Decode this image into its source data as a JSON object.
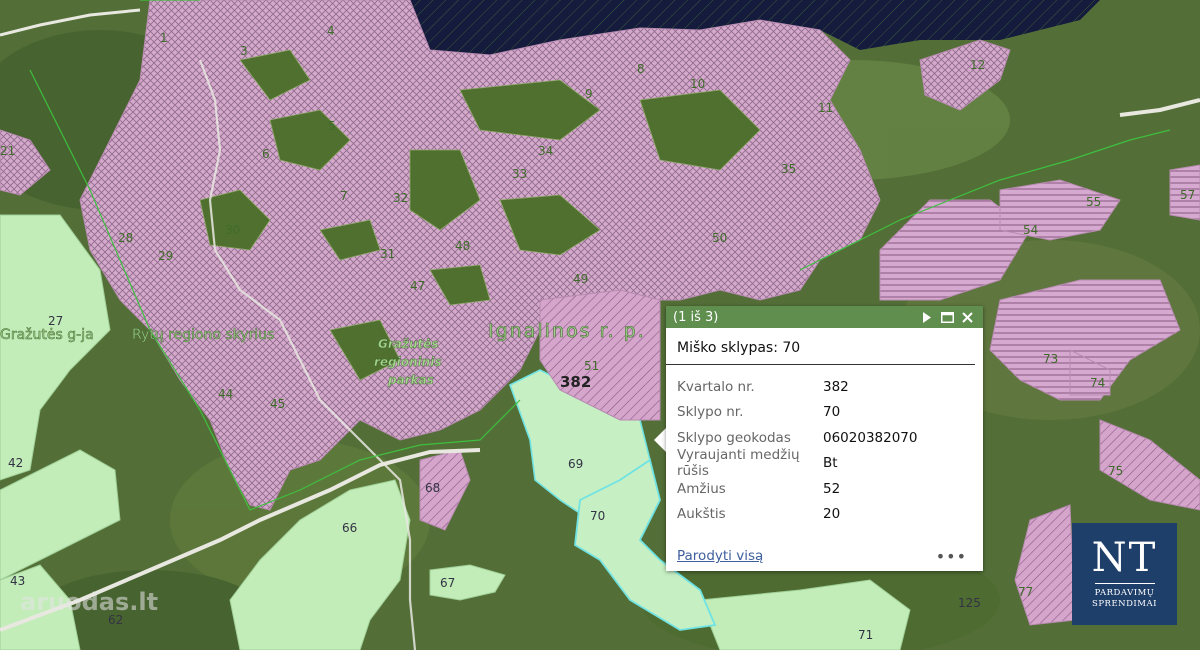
{
  "map": {
    "quarter_number": "382",
    "region_labels": {
      "district": "Ignalinos r. p.",
      "department": "Rytų regiono skyrius",
      "gazutes_forest": "Gražutės g-ja"
    },
    "park_label": [
      "Gražutės",
      "regioninis",
      "parkas"
    ],
    "plot_labels": [
      "1",
      "3",
      "4",
      "5",
      "6",
      "7",
      "8",
      "9",
      "10",
      "11",
      "12",
      "21",
      "28",
      "29",
      "30",
      "31",
      "32",
      "33",
      "34",
      "35",
      "42",
      "43",
      "44",
      "45",
      "47",
      "48",
      "49",
      "50",
      "51",
      "54",
      "55",
      "57",
      "62",
      "66",
      "67",
      "68",
      "69",
      "70",
      "71",
      "73",
      "74",
      "75",
      "77",
      "125",
      "27"
    ],
    "colors": {
      "selected_plot_fill": "#c6f0c4",
      "selected_plot_outline": "#6fe3e3",
      "protected_hatch": "#d9a9d0",
      "forest_plot_fill": "#c2ecb8"
    }
  },
  "popup": {
    "counter": "(1 iš 3)",
    "title": "Miško sklypas: 70",
    "attributes": [
      {
        "label": "Kvartalo nr.",
        "value": "382"
      },
      {
        "label": "Sklypo nr.",
        "value": "70"
      },
      {
        "label": "Sklypo geokodas",
        "value": "06020382070"
      },
      {
        "label": "Vyraujanti medžių rūšis",
        "value": "Bt"
      },
      {
        "label": "Amžius",
        "value": "52"
      },
      {
        "label": "Aukštis",
        "value": "20"
      }
    ],
    "zoom_link": "Parodyti visą",
    "more_icon": "more-horizontal-icon",
    "colors": {
      "header": "#5f8e4e"
    }
  },
  "logo": {
    "mark": "NT",
    "line1": "PARDAVIMŲ",
    "line2": "SPRENDIMAI"
  },
  "watermark": "aruodas.lt"
}
